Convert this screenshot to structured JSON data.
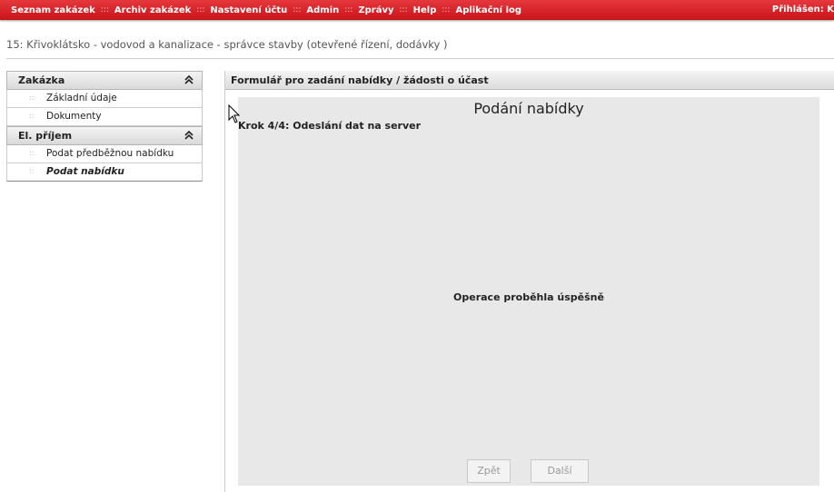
{
  "nav": {
    "items": [
      "Seznam zakázek",
      "Archiv zakázek",
      "Nastavení účtu",
      "Admin",
      "Zprávy",
      "Help",
      "Aplikační log"
    ],
    "separator": ":::",
    "login": "Přihlášen: K"
  },
  "page_title": "15: Křivoklátsko - vodovod a kanalizace - správce stavby (otevřené řízení, dodávky )",
  "sidebar": {
    "sections": [
      {
        "title": "Zakázka",
        "collapse_icon": "double-chevron-up-icon",
        "items": [
          "Základní údaje",
          "Dokumenty"
        ]
      },
      {
        "title": "El. příjem",
        "collapse_icon": "double-chevron-up-icon",
        "items": [
          "Podat předběžnou nabídku",
          "Podat nabídku"
        ]
      }
    ],
    "active_item": "Podat nabídku"
  },
  "main": {
    "header": "Formulář pro zadání nabídky / žádosti o účast",
    "panel_title": "Podání nabídky",
    "step": "Krok 4/4: Odeslání dat na server",
    "status": "Operace proběhla úspěšně",
    "buttons": {
      "back": "Zpět",
      "next": "Další"
    }
  },
  "colors": {
    "nav_bg": "#d8252b",
    "panel_bg": "#e8e8e8",
    "disabled_text": "#999999"
  }
}
